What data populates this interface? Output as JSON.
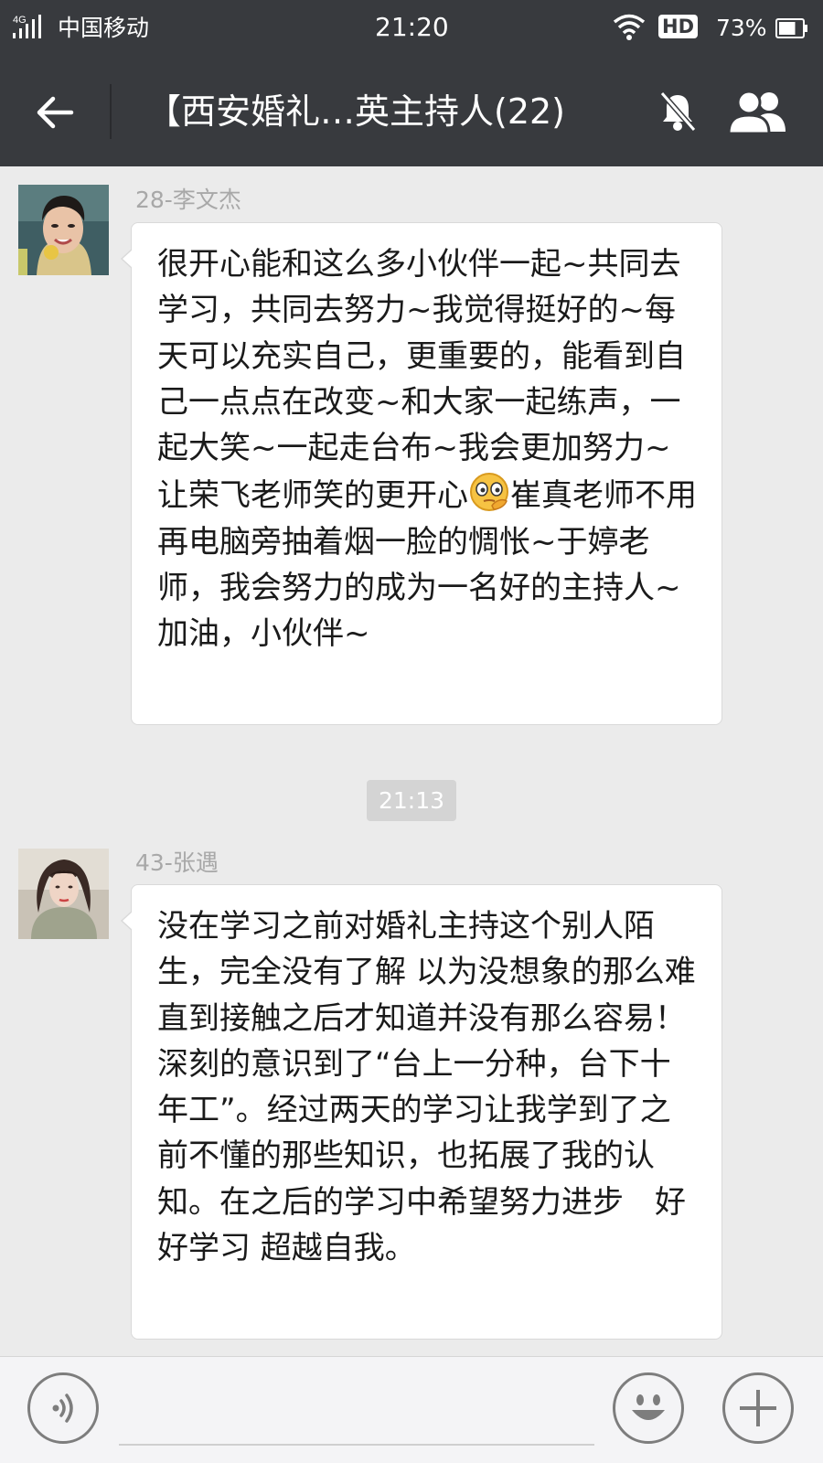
{
  "status_bar": {
    "network": "4G",
    "carrier": "中国移动",
    "time": "21:20",
    "hd_label": "HD",
    "battery": "73%",
    "battery_level": 0.73
  },
  "header": {
    "title": "【西安婚礼…英主持人(22)",
    "back_icon": "arrow-left-icon",
    "mute_icon": "bell-off-icon",
    "members_icon": "group-icon"
  },
  "messages": [
    {
      "sender": "28-李文杰",
      "text_before_emoji": "很开心能和这么多小伙伴一起~共同去学习，共同去努力~我觉得挺好的~每天可以充实自己，更重要的，能看到自己一点点在改变~和大家一起练声，一起大笑~一起走台布~我会更加努力~让荣飞老师笑的更开心",
      "emoji": "thinking-face-emoji",
      "text_after_emoji": "崔真老师不用再电脑旁抽着烟一脸的惆怅~于婷老师，我会努力的成为一名好的主持人~加油，小伙伴~"
    },
    {
      "sender": "43-张遇",
      "text": "没在学习之前对婚礼主持这个别人陌生，完全没有了解 以为没想象的那么难 直到接触之后才知道并没有那么容易！深刻的意识到了“台上一分种，台下十年工”。经过两天的学习让我学到了之前不懂的那些知识，也拓展了我的认知。在之后的学习中希望努力进步　好好学习 超越自我。"
    }
  ],
  "time_separator": "21:13",
  "input_bar": {
    "voice_icon": "voice-icon",
    "emoji_icon": "smiley-icon",
    "plus_icon": "plus-icon"
  },
  "colors": {
    "header_bg": "#383a3e",
    "chat_bg": "#ebebeb",
    "bubble_bg": "#ffffff",
    "sender_text": "#a8a8a8"
  }
}
